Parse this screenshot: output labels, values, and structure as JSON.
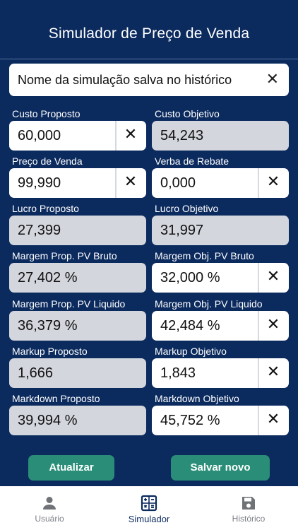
{
  "header": {
    "title": "Simulador de Preço de Venda"
  },
  "simulation_name": {
    "value": "Nome da simulação salva no histórico",
    "clear_icon": "✕"
  },
  "fields": {
    "custo_proposto": {
      "label": "Custo Proposto",
      "value": "60,000"
    },
    "custo_objetivo": {
      "label": "Custo Objetivo",
      "value": "54,243"
    },
    "preco_venda": {
      "label": "Preço de Venda",
      "value": "99,990"
    },
    "verba_rebate": {
      "label": "Verba de Rebate",
      "value": "0,000"
    },
    "lucro_proposto": {
      "label": "Lucro Proposto",
      "value": "27,399"
    },
    "lucro_objetivo": {
      "label": "Lucro Objetivo",
      "value": "31,997"
    },
    "margem_prop_bruto": {
      "label": "Margem Prop. PV Bruto",
      "value": "27,402 %"
    },
    "margem_obj_bruto": {
      "label": "Margem Obj. PV Bruto",
      "value": "32,000 %"
    },
    "margem_prop_liquido": {
      "label": "Margem Prop. PV Liquido",
      "value": "36,379 %"
    },
    "margem_obj_liquido": {
      "label": "Margem Obj. PV Liquido",
      "value": "42,484 %"
    },
    "markup_proposto": {
      "label": "Markup Proposto",
      "value": "1,666"
    },
    "markup_objetivo": {
      "label": "Markup Objetivo",
      "value": "1,843"
    },
    "markdown_proposto": {
      "label": "Markdown Proposto",
      "value": "39,994 %"
    },
    "markdown_objetivo": {
      "label": "Markdown Objetivo",
      "value": "45,752 %"
    }
  },
  "clear_icon": "✕",
  "buttons": {
    "update": "Atualizar",
    "save_new": "Salvar novo"
  },
  "tabs": [
    {
      "label": "Usuário",
      "icon": "person-icon"
    },
    {
      "label": "Simulador",
      "icon": "calculator-icon",
      "active": true
    },
    {
      "label": "Histórico",
      "icon": "save-icon"
    }
  ],
  "colors": {
    "background": "#0b2a5e",
    "button": "#2a8d77",
    "readonly": "#d3d6dd"
  }
}
